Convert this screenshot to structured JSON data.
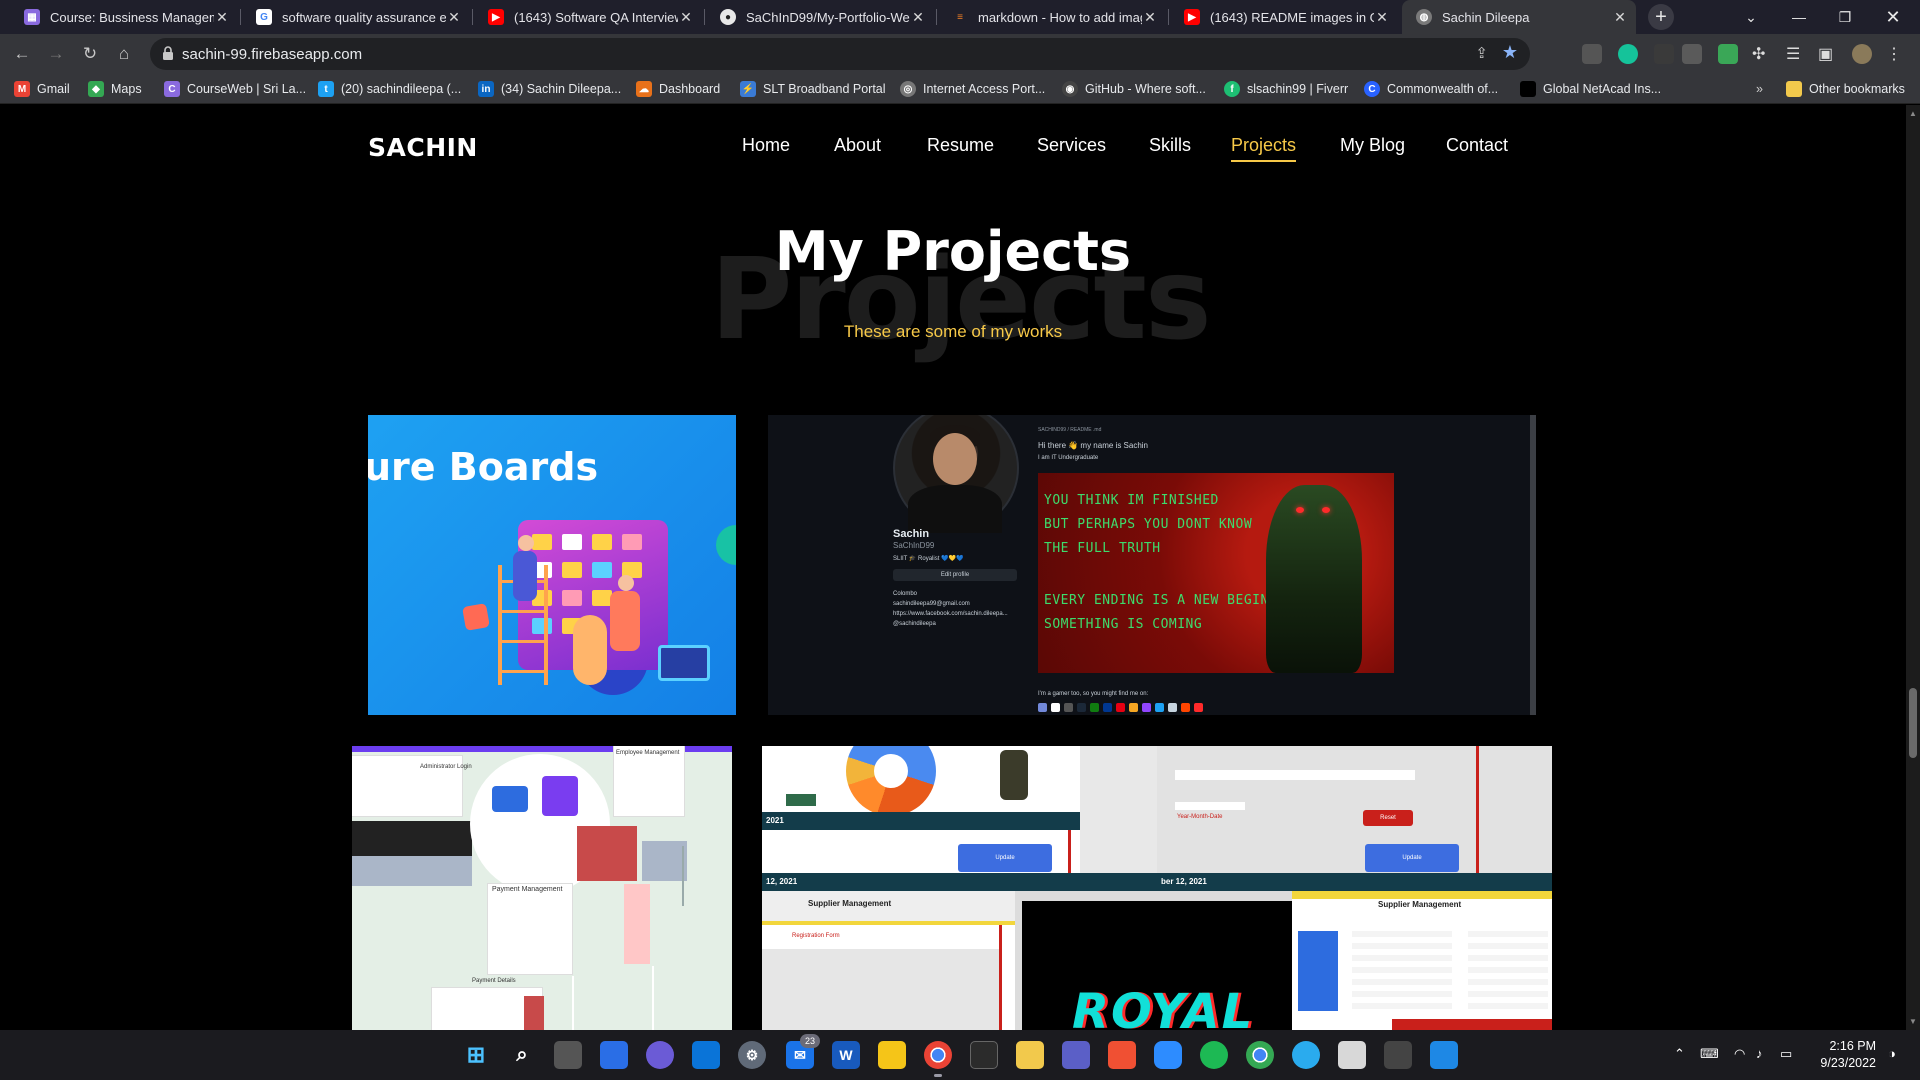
{
  "browser": {
    "tabs": [
      {
        "title": "Course: Bussiness Manageme",
        "icon": "course-icon",
        "color": "#8a6adf"
      },
      {
        "title": "software quality assurance en",
        "icon": "google-icon",
        "color": "#4285f4"
      },
      {
        "title": "(1643) Software QA Interview",
        "icon": "youtube-icon",
        "color": "#ff0000"
      },
      {
        "title": "SaChInD99/My-Portfolio-Wel",
        "icon": "github-icon",
        "color": "#333"
      },
      {
        "title": "markdown - How to add imag",
        "icon": "stackoverflow-icon",
        "color": "#f48024"
      },
      {
        "title": "(1643) README images in Git",
        "icon": "youtube-icon",
        "color": "#ff0000"
      },
      {
        "title": "Sachin Dileepa",
        "icon": "globe-icon",
        "color": "#8a8a8a"
      }
    ],
    "url": "sachin-99.firebaseapp.com",
    "bookmarks": [
      {
        "label": "Gmail",
        "color": "#ea4335",
        "glyph": "M"
      },
      {
        "label": "Maps",
        "color": "#34a853",
        "glyph": "◆"
      },
      {
        "label": "CourseWeb | Sri La...",
        "color": "#8a6adf",
        "glyph": "C"
      },
      {
        "label": "(20) sachindileepa (...",
        "color": "#1da1f2",
        "glyph": "t"
      },
      {
        "label": "(34) Sachin Dileepa...",
        "color": "#0a66c2",
        "glyph": "in"
      },
      {
        "label": "Dashboard",
        "color": "#e8711a",
        "glyph": "☁"
      },
      {
        "label": "SLT Broadband Portal",
        "color": "#3a7bd5",
        "glyph": "⚡"
      },
      {
        "label": "Internet Access Port...",
        "color": "#777",
        "glyph": "◎"
      },
      {
        "label": "GitHub - Where soft...",
        "color": "#444",
        "glyph": "◉"
      },
      {
        "label": "slsachin99 | Fiverr",
        "color": "#1dbf73",
        "glyph": "f"
      },
      {
        "label": "Commonwealth of...",
        "color": "#2962ff",
        "glyph": "C"
      },
      {
        "label": "Global NetAcad Ins...",
        "color": "#000",
        "glyph": ""
      }
    ],
    "other_bookmarks": "Other bookmarks"
  },
  "site": {
    "logo": "SACHIN",
    "menu": [
      "Home",
      "About",
      "Resume",
      "Services",
      "Skills",
      "Projects",
      "My Blog",
      "Contact"
    ],
    "active_menu": "Projects",
    "heading": "My Projects",
    "heading_bg": "Projects",
    "subheading": "These are some of my works",
    "accent": "#f7c948"
  },
  "projects": {
    "card1": {
      "title": "ure Boards"
    },
    "card2": {
      "name": "Sachin",
      "handle": "SaChInD99",
      "bio": "SLIIT 🎓 Royalist 💙💛💙",
      "edit_label": "Edit profile",
      "location": "Colombo",
      "email": "sachindileepa99@gmail.com",
      "link": "https://www.facebook.com/sachin.dileepa...",
      "twitter": "@sachindileepa",
      "readme_path": "SACHIND99 / README .md",
      "greeting": "Hi there 👋 my name is Sachin",
      "subline": "I am IT Undergraduate",
      "banner_lines": [
        "YOU THINK IM FINISHED",
        "BUT PERHAPS YOU DONT KNOW",
        "THE FULL TRUTH",
        "",
        "EVERY ENDING IS A NEW BEGINNING",
        "SOMETHING IS COMING"
      ],
      "gamer_line": "I'm a gamer too, so you might find me on:"
    },
    "card3": {
      "labels": [
        "Administrator Login",
        "Employee Management",
        "Payment Management",
        "Payment Details"
      ]
    },
    "card4": {
      "years": [
        "2021",
        "12, 2021",
        "ber 12, 2021"
      ],
      "update_label": "Update",
      "reset_label": "Reset",
      "ytd_label": "Year-Month-Date",
      "supplier_title": "Supplier Management",
      "supplier_title_2": "Supplier Management",
      "registration_label": "Registration Form",
      "royal": "ROYAL"
    }
  },
  "taskbar": {
    "time": "2:16 PM",
    "date": "9/23/2022",
    "mail_badge": "23"
  }
}
